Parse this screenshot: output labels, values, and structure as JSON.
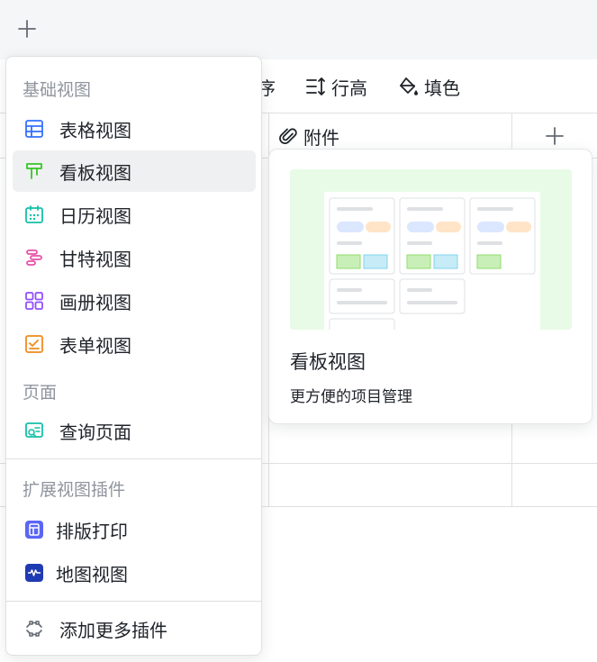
{
  "tabbar": {
    "add_icon": "plus-icon"
  },
  "toolbar": {
    "sort_label": "序",
    "rowheight_label": "行高",
    "fill_label": "填色"
  },
  "grid": {
    "attach_column": "附件",
    "add_column_icon": "plus-icon"
  },
  "menu": {
    "sections": {
      "basic": "基础视图",
      "page": "页面",
      "extension": "扩展视图插件"
    },
    "items": [
      {
        "label": "表格视图",
        "icon": "table-view-icon",
        "color": "#3370ff"
      },
      {
        "label": "看板视图",
        "icon": "kanban-view-icon",
        "color": "#34c724",
        "active": true
      },
      {
        "label": "日历视图",
        "icon": "calendar-view-icon",
        "color": "#14c0a8"
      },
      {
        "label": "甘特视图",
        "icon": "gantt-view-icon",
        "color": "#e750a7"
      },
      {
        "label": "画册视图",
        "icon": "gallery-view-icon",
        "color": "#8f4fff"
      },
      {
        "label": "表单视图",
        "icon": "form-view-icon",
        "color": "#f08a1d"
      },
      {
        "label": "查询页面",
        "icon": "query-page-icon",
        "color": "#14c0a8"
      },
      {
        "label": "排版打印",
        "icon": "layout-print-icon",
        "color": "#5b65f5"
      },
      {
        "label": "地图视图",
        "icon": "map-view-icon",
        "color": "#1f3bb3"
      },
      {
        "label": "添加更多插件",
        "icon": "add-plugin-icon",
        "color": "#646a73"
      }
    ]
  },
  "preview": {
    "title": "看板视图",
    "description": "更方便的项目管理"
  }
}
